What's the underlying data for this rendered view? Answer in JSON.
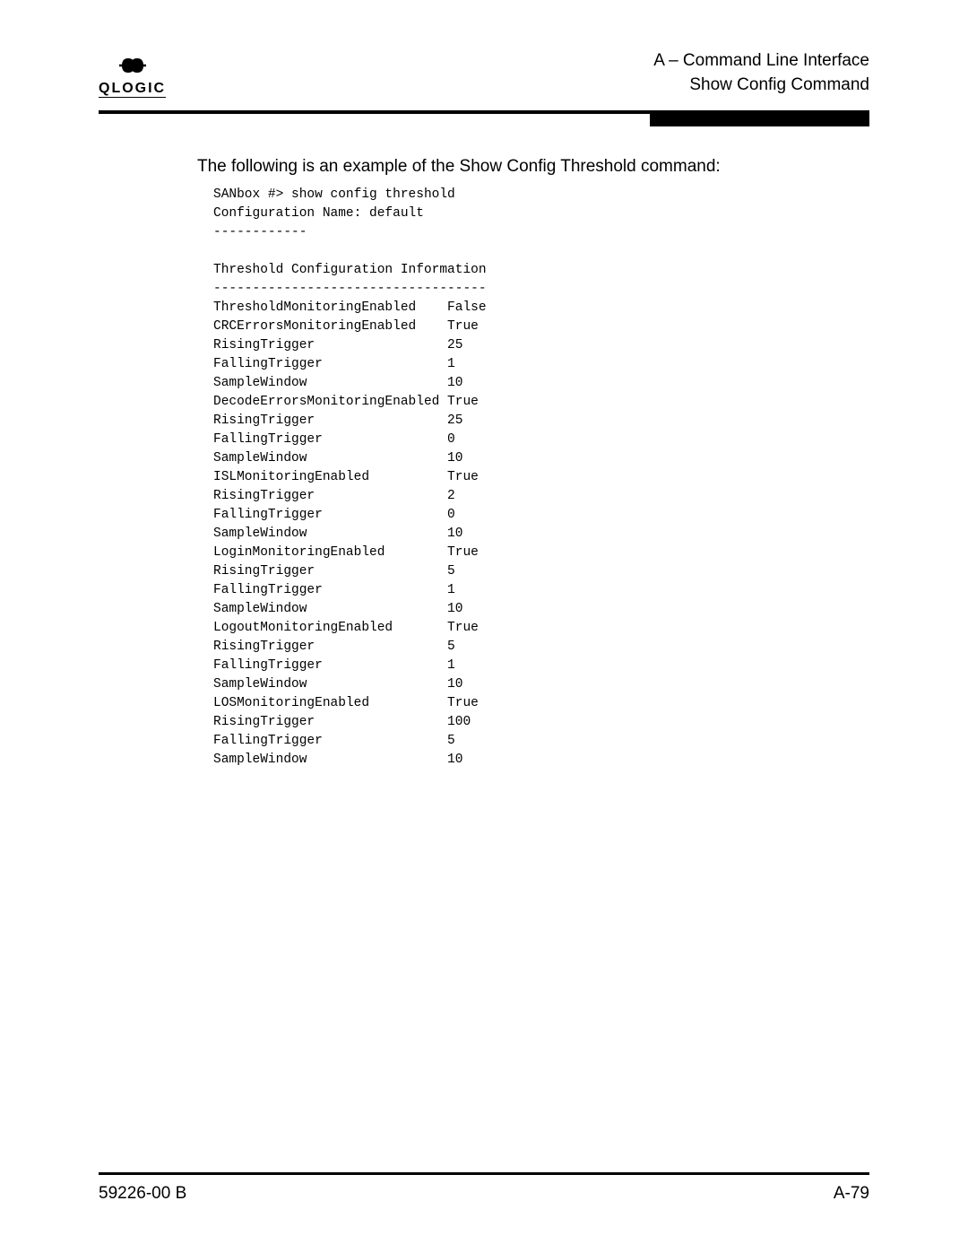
{
  "header": {
    "logo_mark": "ꓛQC",
    "logo_text": "QLOGIC",
    "title_line1": "A – Command Line Interface",
    "title_line2": "Show Config Command"
  },
  "intro": "The following is an example of the Show Config Threshold command:",
  "terminal": {
    "prompt_line": "SANbox #> show config threshold",
    "config_name_line": "Configuration Name: default",
    "dash_short": "------------",
    "section_title": "Threshold Configuration Information",
    "dash_long": "-----------------------------------",
    "rows": [
      {
        "label": "ThresholdMonitoringEnabled",
        "value": "False"
      },
      {
        "label": "CRCErrorsMonitoringEnabled",
        "value": "True"
      },
      {
        "label": "RisingTrigger",
        "value": "25"
      },
      {
        "label": "FallingTrigger",
        "value": "1"
      },
      {
        "label": "SampleWindow",
        "value": "10"
      },
      {
        "label": "DecodeErrorsMonitoringEnabled",
        "value": "True"
      },
      {
        "label": "RisingTrigger",
        "value": "25"
      },
      {
        "label": "FallingTrigger",
        "value": "0"
      },
      {
        "label": "SampleWindow",
        "value": "10"
      },
      {
        "label": "ISLMonitoringEnabled",
        "value": "True"
      },
      {
        "label": "RisingTrigger",
        "value": "2"
      },
      {
        "label": "FallingTrigger",
        "value": "0"
      },
      {
        "label": "SampleWindow",
        "value": "10"
      },
      {
        "label": "LoginMonitoringEnabled",
        "value": "True"
      },
      {
        "label": "RisingTrigger",
        "value": "5"
      },
      {
        "label": "FallingTrigger",
        "value": "1"
      },
      {
        "label": "SampleWindow",
        "value": "10"
      },
      {
        "label": "LogoutMonitoringEnabled",
        "value": "True"
      },
      {
        "label": "RisingTrigger",
        "value": "5"
      },
      {
        "label": "FallingTrigger",
        "value": "1"
      },
      {
        "label": "SampleWindow",
        "value": "10"
      },
      {
        "label": "LOSMonitoringEnabled",
        "value": "True"
      },
      {
        "label": "RisingTrigger",
        "value": "100"
      },
      {
        "label": "FallingTrigger",
        "value": "5"
      },
      {
        "label": "SampleWindow",
        "value": "10"
      }
    ]
  },
  "footer": {
    "left": "59226-00 B",
    "right": "A-79"
  }
}
